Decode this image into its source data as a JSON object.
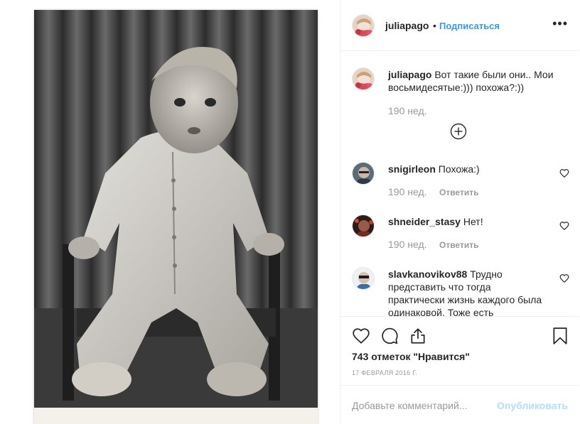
{
  "post": {
    "author": "juliapago",
    "separator": "•",
    "follow_label": "Подписаться",
    "more_label": "•••",
    "caption_author": "juliapago",
    "caption_text": "Вот такие были они.. Мои восьмидесятые:))) похожа?:))",
    "caption_age": "190 нед."
  },
  "comments": [
    {
      "user": "snigirleon",
      "text": "Похожа:)",
      "age": "190 нед.",
      "reply_label": "Ответить"
    },
    {
      "user": "shneider_stasy",
      "text": "Нет!",
      "age": "190 нед.",
      "reply_label": "Ответить"
    },
    {
      "user": "slavkanovikov88",
      "text": "Трудно представить что тогда практически жизнь каждого была одинаковой. Тоже есть",
      "age": "",
      "reply_label": ""
    }
  ],
  "actions": {
    "likes_text": "743 отметок \"Нравится\"",
    "date_text": "17 ФЕВРАЛЯ 2016 Г."
  },
  "add_comment": {
    "placeholder": "Добавьте комментарий...",
    "publish_label": "Опубликовать"
  },
  "colors": {
    "link_blue": "#3897f0",
    "publish_disabled": "#b2dffc",
    "muted_text": "#999999",
    "divider": "#efefef"
  },
  "icons": [
    "heart-icon",
    "comment-icon",
    "share-icon",
    "bookmark-icon",
    "plus-circle-icon",
    "small-heart-icon"
  ]
}
